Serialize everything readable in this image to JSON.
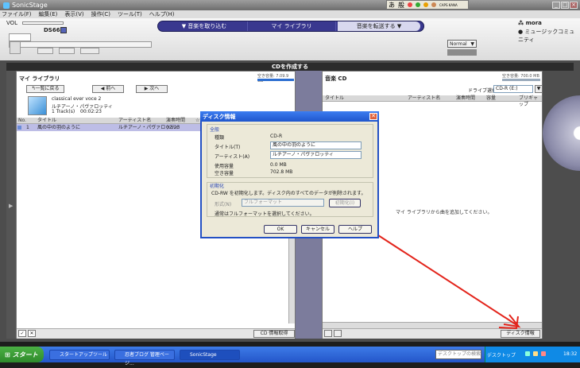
{
  "window": {
    "title": "SonicStage"
  },
  "ime": {
    "label1": "あ",
    "label2": "般",
    "label3": "CAPS KANA"
  },
  "menu": [
    "ファイル(F)",
    "編集(E)",
    "表示(V)",
    "操作(C)",
    "ツール(T)",
    "ヘルプ(H)"
  ],
  "header": {
    "vol_label": "VOL",
    "device": "DS66",
    "mora": "mora",
    "community": "ミュージックコミュニティ",
    "quality": "Normal",
    "nav": [
      "音楽を取り込む",
      "マイ ライブラリ",
      "音楽を転送する"
    ],
    "ctrl": [
      "",
      "",
      "",
      ""
    ]
  },
  "section": {
    "title": "CDを作成する"
  },
  "left": {
    "title": "マイ ライブラリ",
    "capacity": "空き容量: 7.09.9 GB",
    "back_btn": "一覧に戻る",
    "prev_btn": "前へ",
    "next_btn": "次へ",
    "album": "classical ever voce 2",
    "artist": "ルチアーノ・パヴァロッティ",
    "tracks": "1 Track(s)",
    "duration": "00:02:23",
    "columns": [
      "No.",
      "タイトル",
      "アーティスト名",
      "演奏時間",
      "☆"
    ],
    "rows": [
      {
        "no": "1",
        "title": "風の中の羽のように",
        "artist": "ルチアーノ・パヴァロッティ",
        "time": "02:23"
      }
    ],
    "cd_info_btn": "CD 情報取得"
  },
  "right": {
    "title": "音楽 CD",
    "capacity": "空き容量: 700.0 MB",
    "drive_label": "ドライブ選択",
    "drive_value": "CD-R (E:)",
    "columns": [
      "タイトル",
      "アーティスト名",
      "演奏時間",
      "容量",
      "ブリギャップ"
    ],
    "hint": "マイ ライブラリから曲を追加してください。",
    "disc_info_btn": "ディスク情報"
  },
  "dialog": {
    "title": "ディスク情報",
    "general": "全般",
    "type_label": "種類",
    "type_value": "CD-R",
    "title_label": "タイトル(T)",
    "title_value": "風の中の羽のように",
    "artist_label": "アーティスト(A)",
    "artist_value": "ルチアーノ・パヴァロッティ",
    "used_label": "使用容量",
    "used_value": "0.0 MB",
    "free_label": "空き容量",
    "free_value": "702.8 MB",
    "init": "初期化",
    "init_desc": "CD-RW を初期化します。ディスク内のすべてのデータが削除されます。",
    "format_label": "形式(N)",
    "format_value": "フルフォーマット",
    "init_btn": "初期化(I)",
    "note": "通常はフルフォーマットを選択してください。",
    "ok": "OK",
    "cancel": "キャンセル",
    "help": "ヘルプ"
  },
  "taskbar": {
    "start": "スタート",
    "tasks": [
      "スタートアップツール",
      "忍者ブログ 管理ページ...",
      "SonicStage"
    ],
    "search": "デスクトップの検索",
    "desktop": "デスクトップ",
    "clock": "18:32"
  }
}
